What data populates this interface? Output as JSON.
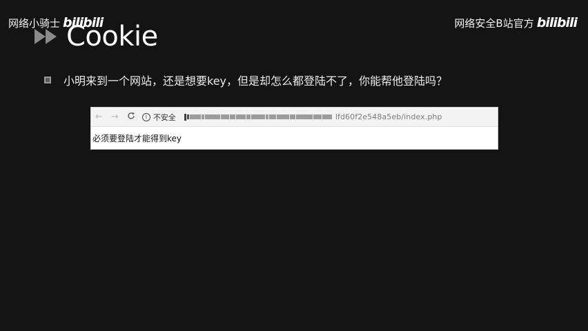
{
  "watermark_left": {
    "text": "网络小骑士",
    "logo": "bilibili"
  },
  "watermark_right": {
    "text": "网络安全B站官方",
    "logo": "bilibili"
  },
  "slide": {
    "title": "Cookie",
    "title_icon": "double-play-arrow-icon",
    "bullet_text": "小明来到一个网站，还是想要key，但是却怎么都登陆不了，你能帮他登陆吗？"
  },
  "browser": {
    "back_icon": "←",
    "forward_icon": "→",
    "reload_icon": "C",
    "info_icon": "i",
    "security_label": "不安全",
    "url_visible": "lfd60f2e548a5eb/index.php",
    "page_text": "必须要登陆才能得到key"
  }
}
